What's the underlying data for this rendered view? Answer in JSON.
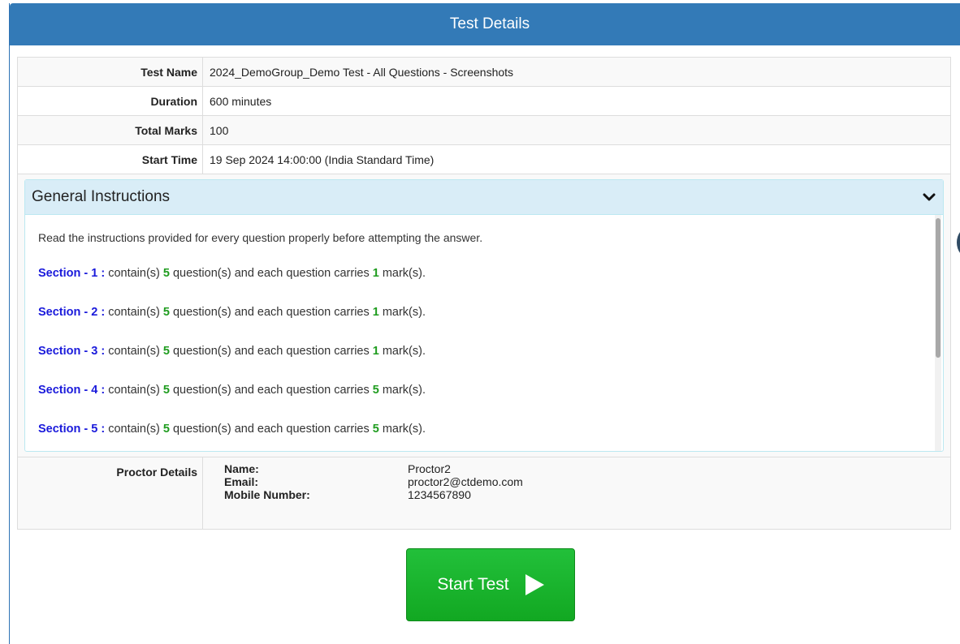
{
  "header": {
    "title": "Test Details"
  },
  "details": [
    {
      "label": "Test Name",
      "value": "2024_DemoGroup_Demo Test - All Questions - Screenshots"
    },
    {
      "label": "Duration",
      "value": "600 minutes"
    },
    {
      "label": "Total Marks",
      "value": "100"
    },
    {
      "label": "Start Time",
      "value": "19 Sep 2024 14:00:00 (India Standard Time)"
    }
  ],
  "instructions": {
    "title": "General Instructions",
    "intro": "Read the instructions provided for every question properly before attempting the answer.",
    "sections": [
      {
        "name": "Section - 1 :",
        "t1": "contain(s)",
        "questions": "5",
        "t2": "question(s) and each question carries",
        "marks": "1",
        "t3": "mark(s)."
      },
      {
        "name": "Section - 2 :",
        "t1": "contain(s)",
        "questions": "5",
        "t2": "question(s) and each question carries",
        "marks": "1",
        "t3": "mark(s)."
      },
      {
        "name": "Section - 3 :",
        "t1": "contain(s)",
        "questions": "5",
        "t2": "question(s) and each question carries",
        "marks": "1",
        "t3": "mark(s)."
      },
      {
        "name": "Section - 4 :",
        "t1": "contain(s)",
        "questions": "5",
        "t2": "question(s) and each question carries",
        "marks": "5",
        "t3": "mark(s)."
      },
      {
        "name": "Section - 5 :",
        "t1": "contain(s)",
        "questions": "5",
        "t2": "question(s) and each question carries",
        "marks": "5",
        "t3": "mark(s)."
      }
    ]
  },
  "proctor": {
    "label": "Proctor Details",
    "name_key": "Name:",
    "name": "Proctor2",
    "email_key": "Email:",
    "email": "proctor2@ctdemo.com",
    "mobile_key": "Mobile Number:",
    "mobile": "1234567890"
  },
  "start_button": {
    "label": "Start Test"
  },
  "colors": {
    "header": "#337ab7",
    "section": "#1a1adb",
    "number": "#1f9c1f",
    "button": "#17b22b"
  }
}
